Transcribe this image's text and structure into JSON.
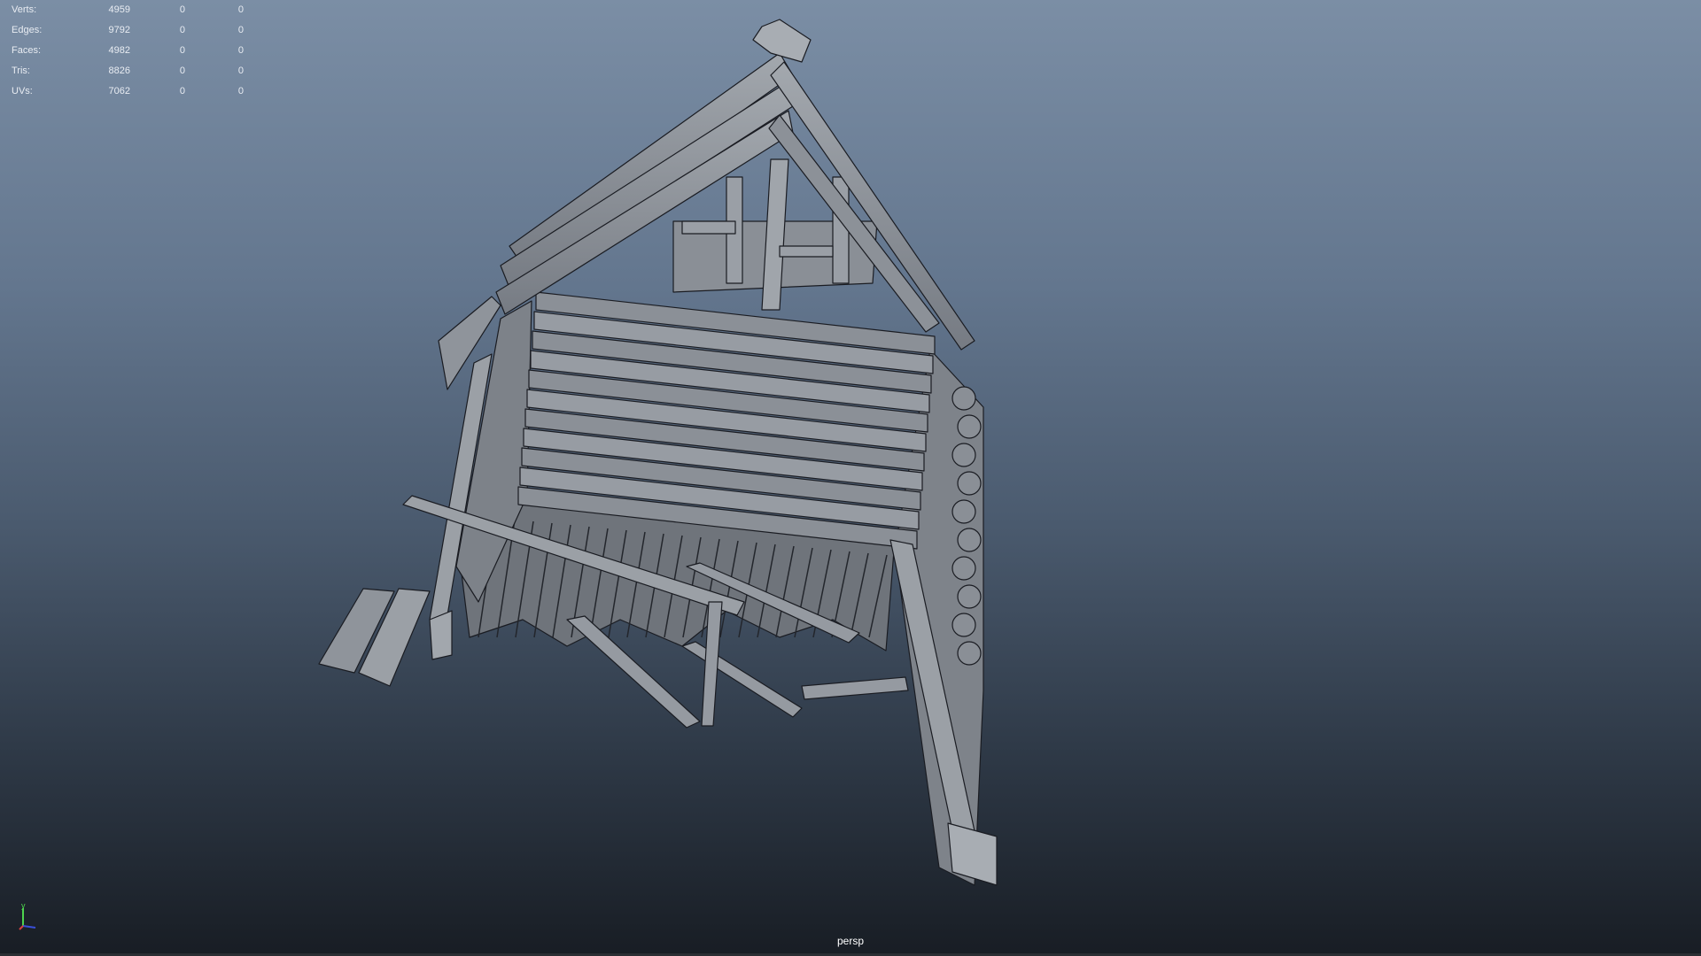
{
  "hud": {
    "rows": [
      {
        "label": "Verts:",
        "v1": "4959",
        "v2": "0",
        "v3": "0"
      },
      {
        "label": "Edges:",
        "v1": "9792",
        "v2": "0",
        "v3": "0"
      },
      {
        "label": "Faces:",
        "v1": "4982",
        "v2": "0",
        "v3": "0"
      },
      {
        "label": "Tris:",
        "v1": "8826",
        "v2": "0",
        "v3": "0"
      },
      {
        "label": "UVs:",
        "v1": "7062",
        "v2": "0",
        "v3": "0"
      }
    ]
  },
  "camera": {
    "name": "persp"
  },
  "axis": {
    "y_label": "y",
    "x_label": "x",
    "z_label": "z"
  },
  "colors": {
    "mesh": "#8f949b",
    "wire": "#1a1c22",
    "background_top": "#7b8ea5",
    "background_bottom": "#181d24"
  }
}
